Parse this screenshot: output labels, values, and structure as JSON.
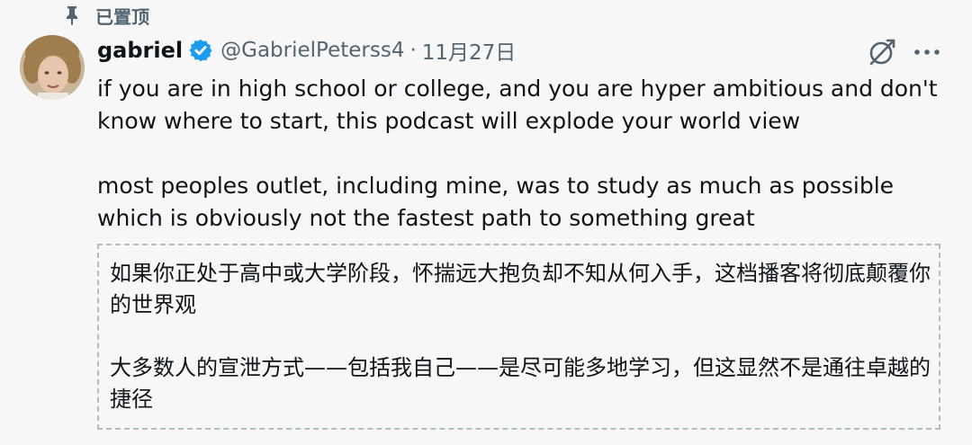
{
  "pinned": {
    "icon": "pin-icon",
    "label": "已置顶"
  },
  "author": {
    "name": "gabriel",
    "verified": true,
    "verified_icon": "verified-badge-icon",
    "verified_color": "#1d9bf0",
    "handle": "@GabrielPeterss4",
    "separator": "·",
    "date": "11月27日",
    "avatar_icon": "avatar-photo"
  },
  "actions": {
    "grok_icon": "grok-icon",
    "more_icon": "more-options-icon"
  },
  "tweet": {
    "paragraphs": [
      "if you are in high school or college, and you are hyper ambitious and don't know where to start, this podcast will explode your world view",
      "most peoples outlet, including mine, was to study as much as possible which is obviously not the fastest path to something great"
    ]
  },
  "translation": {
    "paragraphs": [
      "如果你正处于高中或大学阶段，怀揣远大抱负却不知从何入手，这档播客将彻底颠覆你的世界观",
      "大多数人的宣泄方式——包括我自己——是尽可能多地学习，但这显然不是通往卓越的捷径"
    ]
  },
  "colors": {
    "text": "#0f1419",
    "secondary": "#536471",
    "background": "#f7f7f7",
    "translation_border": "#b3bdc6"
  }
}
